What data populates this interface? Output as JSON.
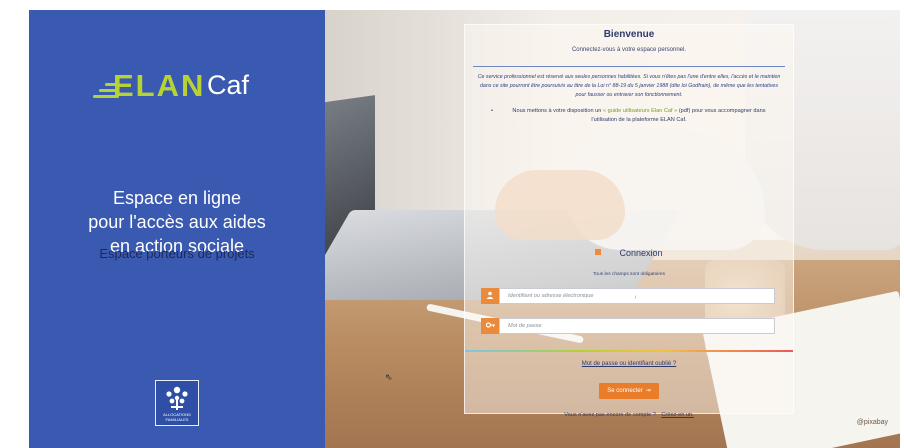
{
  "brand": {
    "name": "ELAN",
    "suffix": "Caf",
    "accent_color": "#b7d332",
    "panel_color": "#3a5ab2"
  },
  "left": {
    "tagline_lines": [
      "Espace en ligne",
      "pour l'accès aux aides",
      "en action sociale"
    ],
    "subtagline": "Espace porteurs de projets",
    "emblem_text": [
      "ALLOCATIONS",
      "FAMILIALES"
    ]
  },
  "card": {
    "title": "Bienvenue",
    "subtitle": "Connectez-vous à votre espace personnel.",
    "notice": "Ce service professionnel est réservé aux seules personnes habilitées. Si vous n'êtes pas l'une d'entre elles, l'accès et le maintien dans ce site pourront être poursuivis au titre de la Loi n° 88-19 du 5 janvier 1988 (dite loi Godfrain), de même que les tentatives pour fausser ou entraver son fonctionnement.",
    "bullet_prefix": "Nous mettons à votre disposition un",
    "bullet_link": "« guide utilisateurs Elan Caf »",
    "bullet_suffix": "(pdf) pour vous accompagner dans l'utilisation de la plateforme ELAN Caf.",
    "connexion_title": "Connexion",
    "required_note": "Tous les champs sont obligatoires",
    "username_placeholder": "Identifiant ou adresse électronique",
    "password_placeholder": "Mot de passe",
    "forgot_link": "Mot de passe ou identifiant oublié ?",
    "submit_label": "Se connecter",
    "submit_arrow": "⇥",
    "accent_color": "#ea7d2a"
  },
  "footer": {
    "no_account": "Vous n'avez pas encore de compte ?",
    "create_link": "Créez-en un."
  },
  "photo_credit": "@pixabay",
  "icons": {
    "user": "user-icon",
    "key": "key-icon",
    "login": "login-arrow-icon",
    "cursor": "mouse-pointer-icon"
  }
}
